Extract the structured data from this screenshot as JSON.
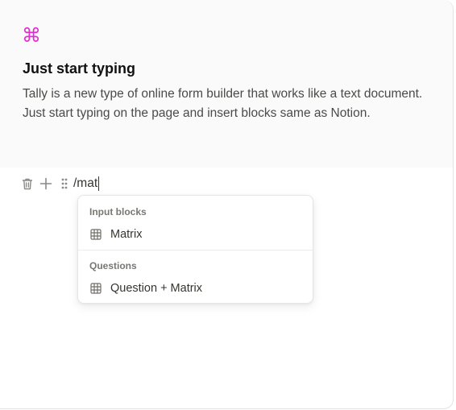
{
  "intro": {
    "icon": "command-icon",
    "icon_glyph": "⌘",
    "icon_color": "#e02fd3",
    "title": "Just start typing",
    "description": "Tally is a new type of online form builder that works like a text document. Just start typing on the page and insert blocks same as Notion."
  },
  "block_tools": {
    "delete_icon": "trash-icon",
    "add_icon": "plus-icon",
    "drag_icon": "drag-handle-icon"
  },
  "slash_input": {
    "value": "/mat"
  },
  "slash_menu": {
    "sections": [
      {
        "label": "Input blocks",
        "items": [
          {
            "label": "Matrix",
            "icon": "table-grid-icon"
          }
        ]
      },
      {
        "label": "Questions",
        "items": [
          {
            "label": "Question + Matrix",
            "icon": "table-grid-icon"
          }
        ]
      }
    ]
  }
}
